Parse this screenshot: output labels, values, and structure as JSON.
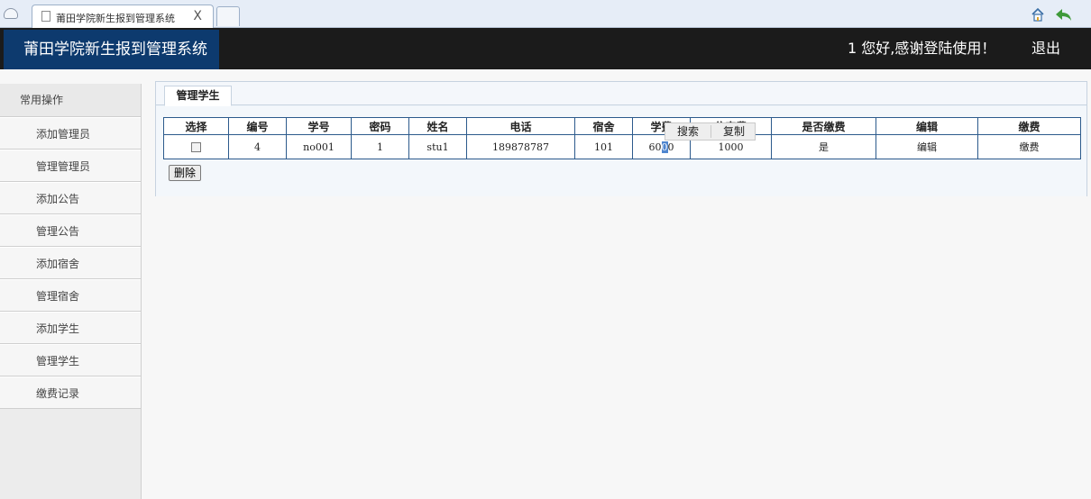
{
  "browser": {
    "tab_title": "莆田学院新生报到管理系统",
    "tab_close": "X"
  },
  "header": {
    "app_title": "莆田学院新生报到管理系统",
    "welcome": "1 您好,感谢登陆使用！",
    "logout": "退出"
  },
  "sidebar": {
    "heading": "常用操作",
    "items": [
      {
        "label": "添加管理员"
      },
      {
        "label": "管理管理员"
      },
      {
        "label": "添加公告"
      },
      {
        "label": "管理公告"
      },
      {
        "label": "添加宿舍"
      },
      {
        "label": "管理宿舍"
      },
      {
        "label": "添加学生"
      },
      {
        "label": "管理学生"
      },
      {
        "label": "缴费记录"
      }
    ]
  },
  "main": {
    "tab_label": "管理学生",
    "columns": [
      "选择",
      "编号",
      "学号",
      "密码",
      "姓名",
      "电话",
      "宿舍",
      "学费",
      "住宿费",
      "是否缴费",
      "编辑",
      "缴费"
    ],
    "row": {
      "id": "4",
      "student_no": "no001",
      "password": "1",
      "name": "stu1",
      "phone": "189878787",
      "dorm": "101",
      "tuition_pre": "60",
      "tuition_sel": "0",
      "tuition_post": "0",
      "lodging": "1000",
      "paid": "是",
      "edit": "编辑",
      "pay": "缴费"
    },
    "delete_label": "删除"
  },
  "context_menu": {
    "search": "搜索",
    "copy": "复制"
  }
}
